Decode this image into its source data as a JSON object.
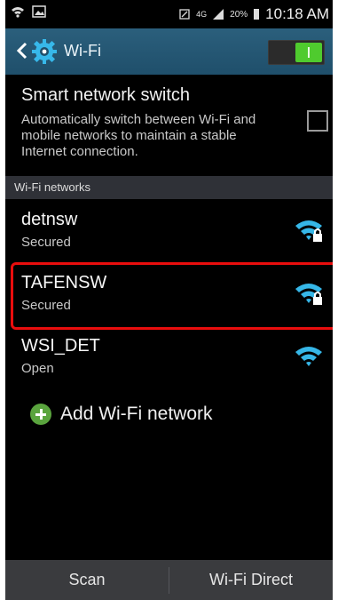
{
  "status_bar": {
    "time": "10:18 AM",
    "network": "4G",
    "battery": "20%"
  },
  "action_bar": {
    "title": "Wi-Fi",
    "toggle_on": true
  },
  "smart_network_switch": {
    "title": "Smart network switch",
    "description": "Automatically switch between Wi-Fi and mobile networks to maintain a stable Internet connection.",
    "checked": false
  },
  "section_header": "Wi-Fi networks",
  "networks": [
    {
      "name": "detnsw",
      "status": "Secured",
      "icon": "wifi-secured-icon"
    },
    {
      "name": "TAFENSW",
      "status": "Secured",
      "icon": "wifi-secured-icon"
    },
    {
      "name": "WSI_DET",
      "status": "Open",
      "icon": "wifi-open-icon"
    }
  ],
  "add_network": {
    "label": "Add Wi-Fi network"
  },
  "bottom_bar": {
    "scan_label": "Scan",
    "wifi_direct_label": "Wi-Fi Direct"
  },
  "colors": {
    "action_bar": "#285a77",
    "accent_wifi": "#36b7e8",
    "highlight": "#ea0d0d",
    "toggle_on": "#4fcb2e"
  }
}
